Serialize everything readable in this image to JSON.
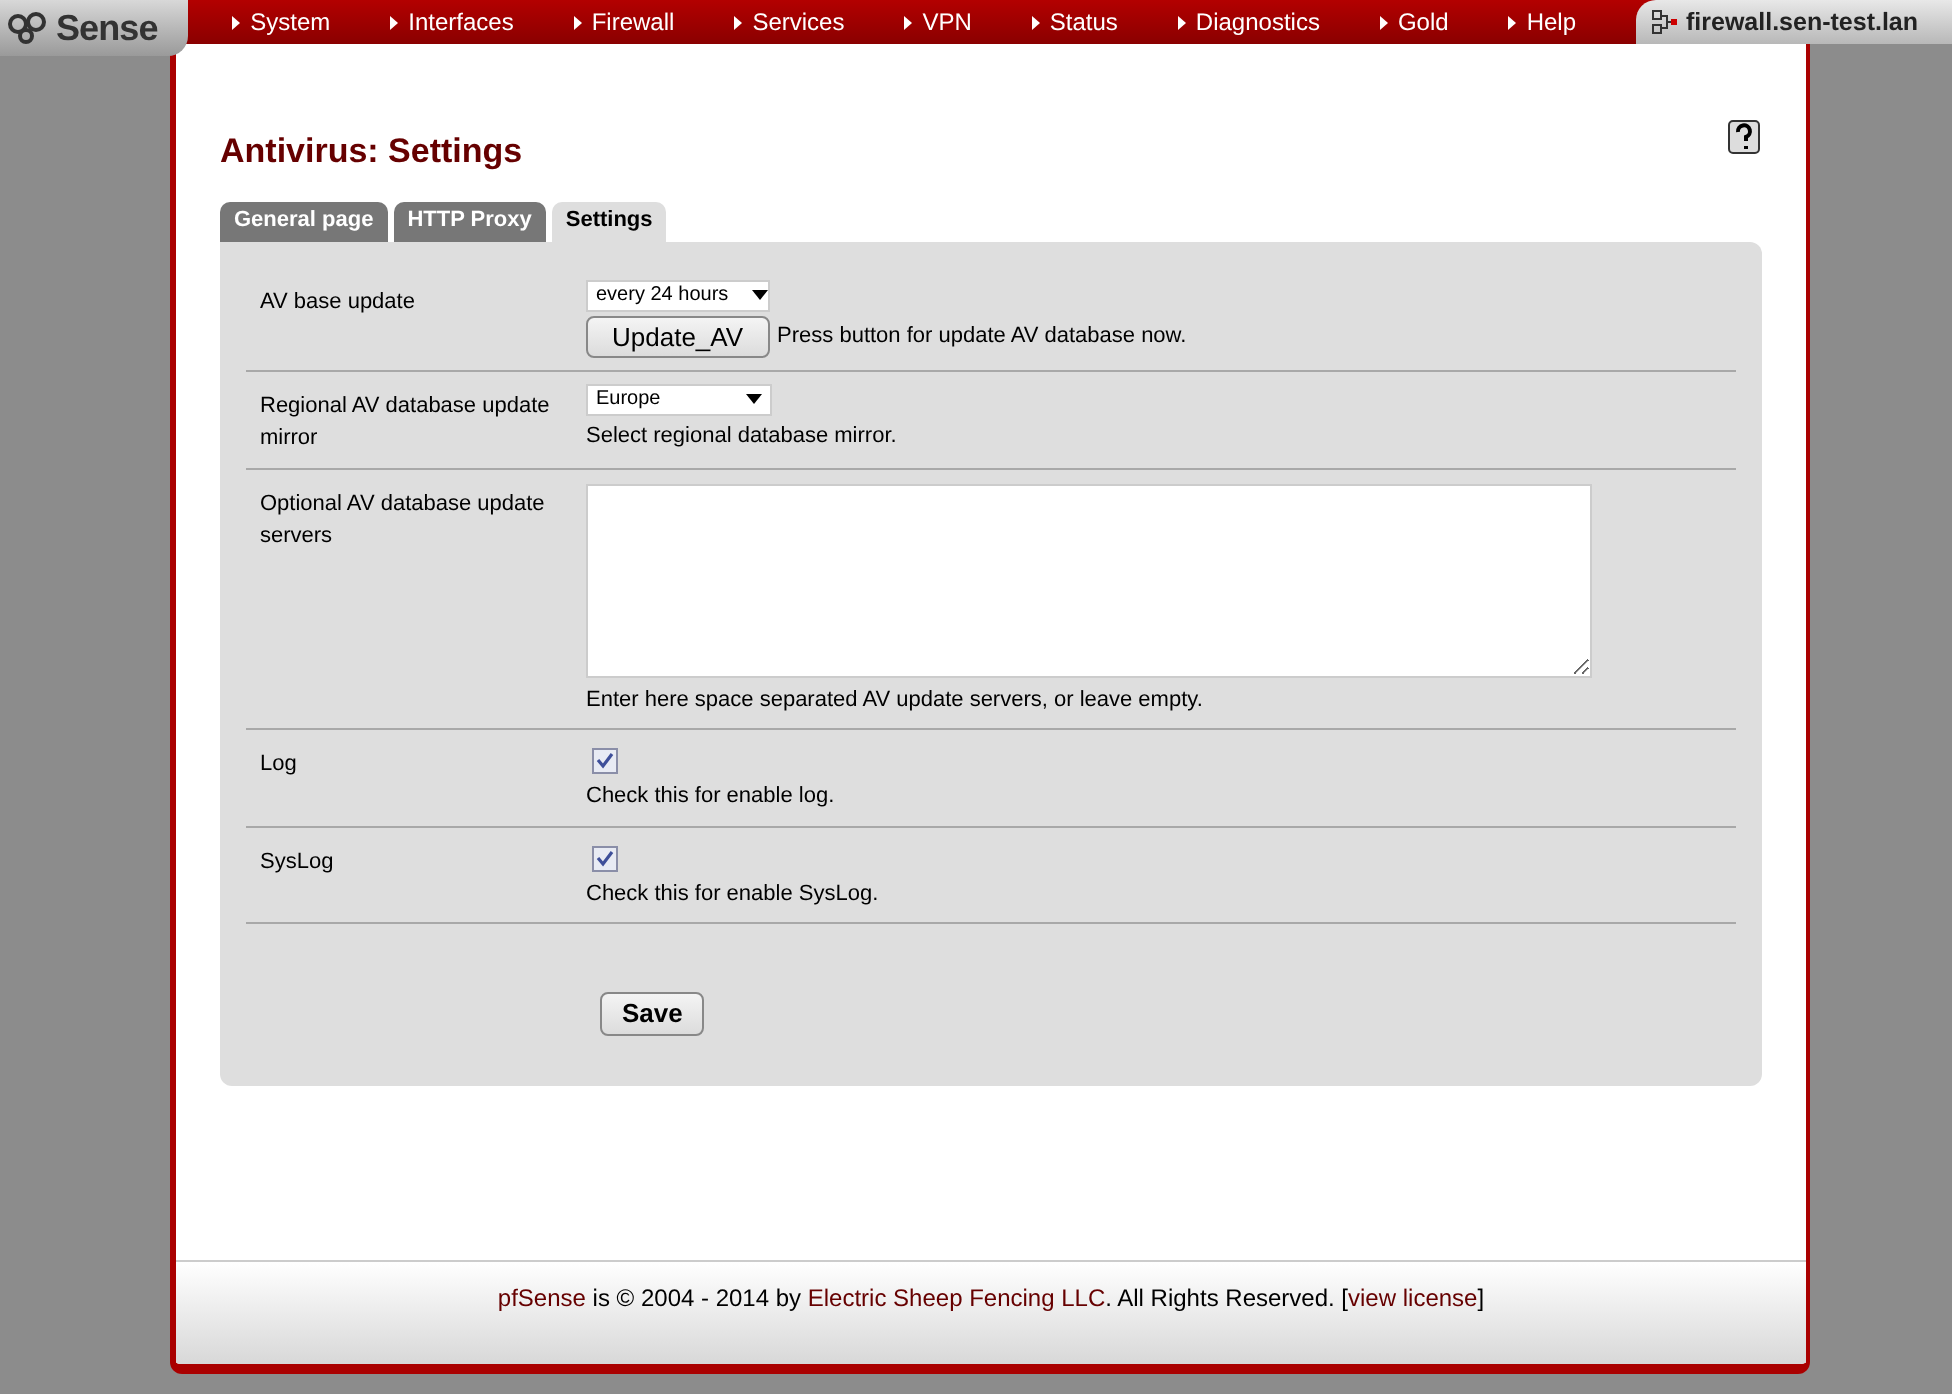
{
  "logo": {
    "text": "Sense"
  },
  "menu": [
    {
      "label": "System"
    },
    {
      "label": "Interfaces"
    },
    {
      "label": "Firewall"
    },
    {
      "label": "Services"
    },
    {
      "label": "VPN"
    },
    {
      "label": "Status"
    },
    {
      "label": "Diagnostics"
    },
    {
      "label": "Gold"
    },
    {
      "label": "Help"
    }
  ],
  "hostname": "firewall.sen-test.lan",
  "page_title": "Antivirus: Settings",
  "tabs": [
    {
      "label": "General page",
      "selected": false
    },
    {
      "label": "HTTP Proxy",
      "selected": false
    },
    {
      "label": "Settings",
      "selected": true
    }
  ],
  "rows": [
    {
      "kind": "select",
      "label": "AV base update",
      "value": "every 24 hours",
      "button": "Update_AV",
      "note": "Press button for update AV database now."
    },
    {
      "kind": "select",
      "label": "Regional AV database update mirror",
      "value": "Europe",
      "note": "Select regional database mirror."
    },
    {
      "kind": "textarea",
      "label": "Optional AV database update servers",
      "note": "Enter here space separated AV update servers, or leave empty."
    },
    {
      "kind": "checkbox",
      "label": "Log",
      "checked": true,
      "note": "Check this for enable log."
    },
    {
      "kind": "checkbox",
      "label": "SysLog",
      "checked": true,
      "note": "Check this for enable SysLog."
    }
  ],
  "save_button": "Save",
  "footer": [
    {
      "text": "pfSense",
      "link": true
    },
    {
      "text": " is © 2004 - 2014 by ",
      "link": false
    },
    {
      "text": "Electric Sheep Fencing LLC",
      "link": true
    },
    {
      "text": ". All Rights Reserved. [",
      "link": false
    },
    {
      "text": "view license",
      "link": true
    },
    {
      "text": "]",
      "link": false
    }
  ]
}
